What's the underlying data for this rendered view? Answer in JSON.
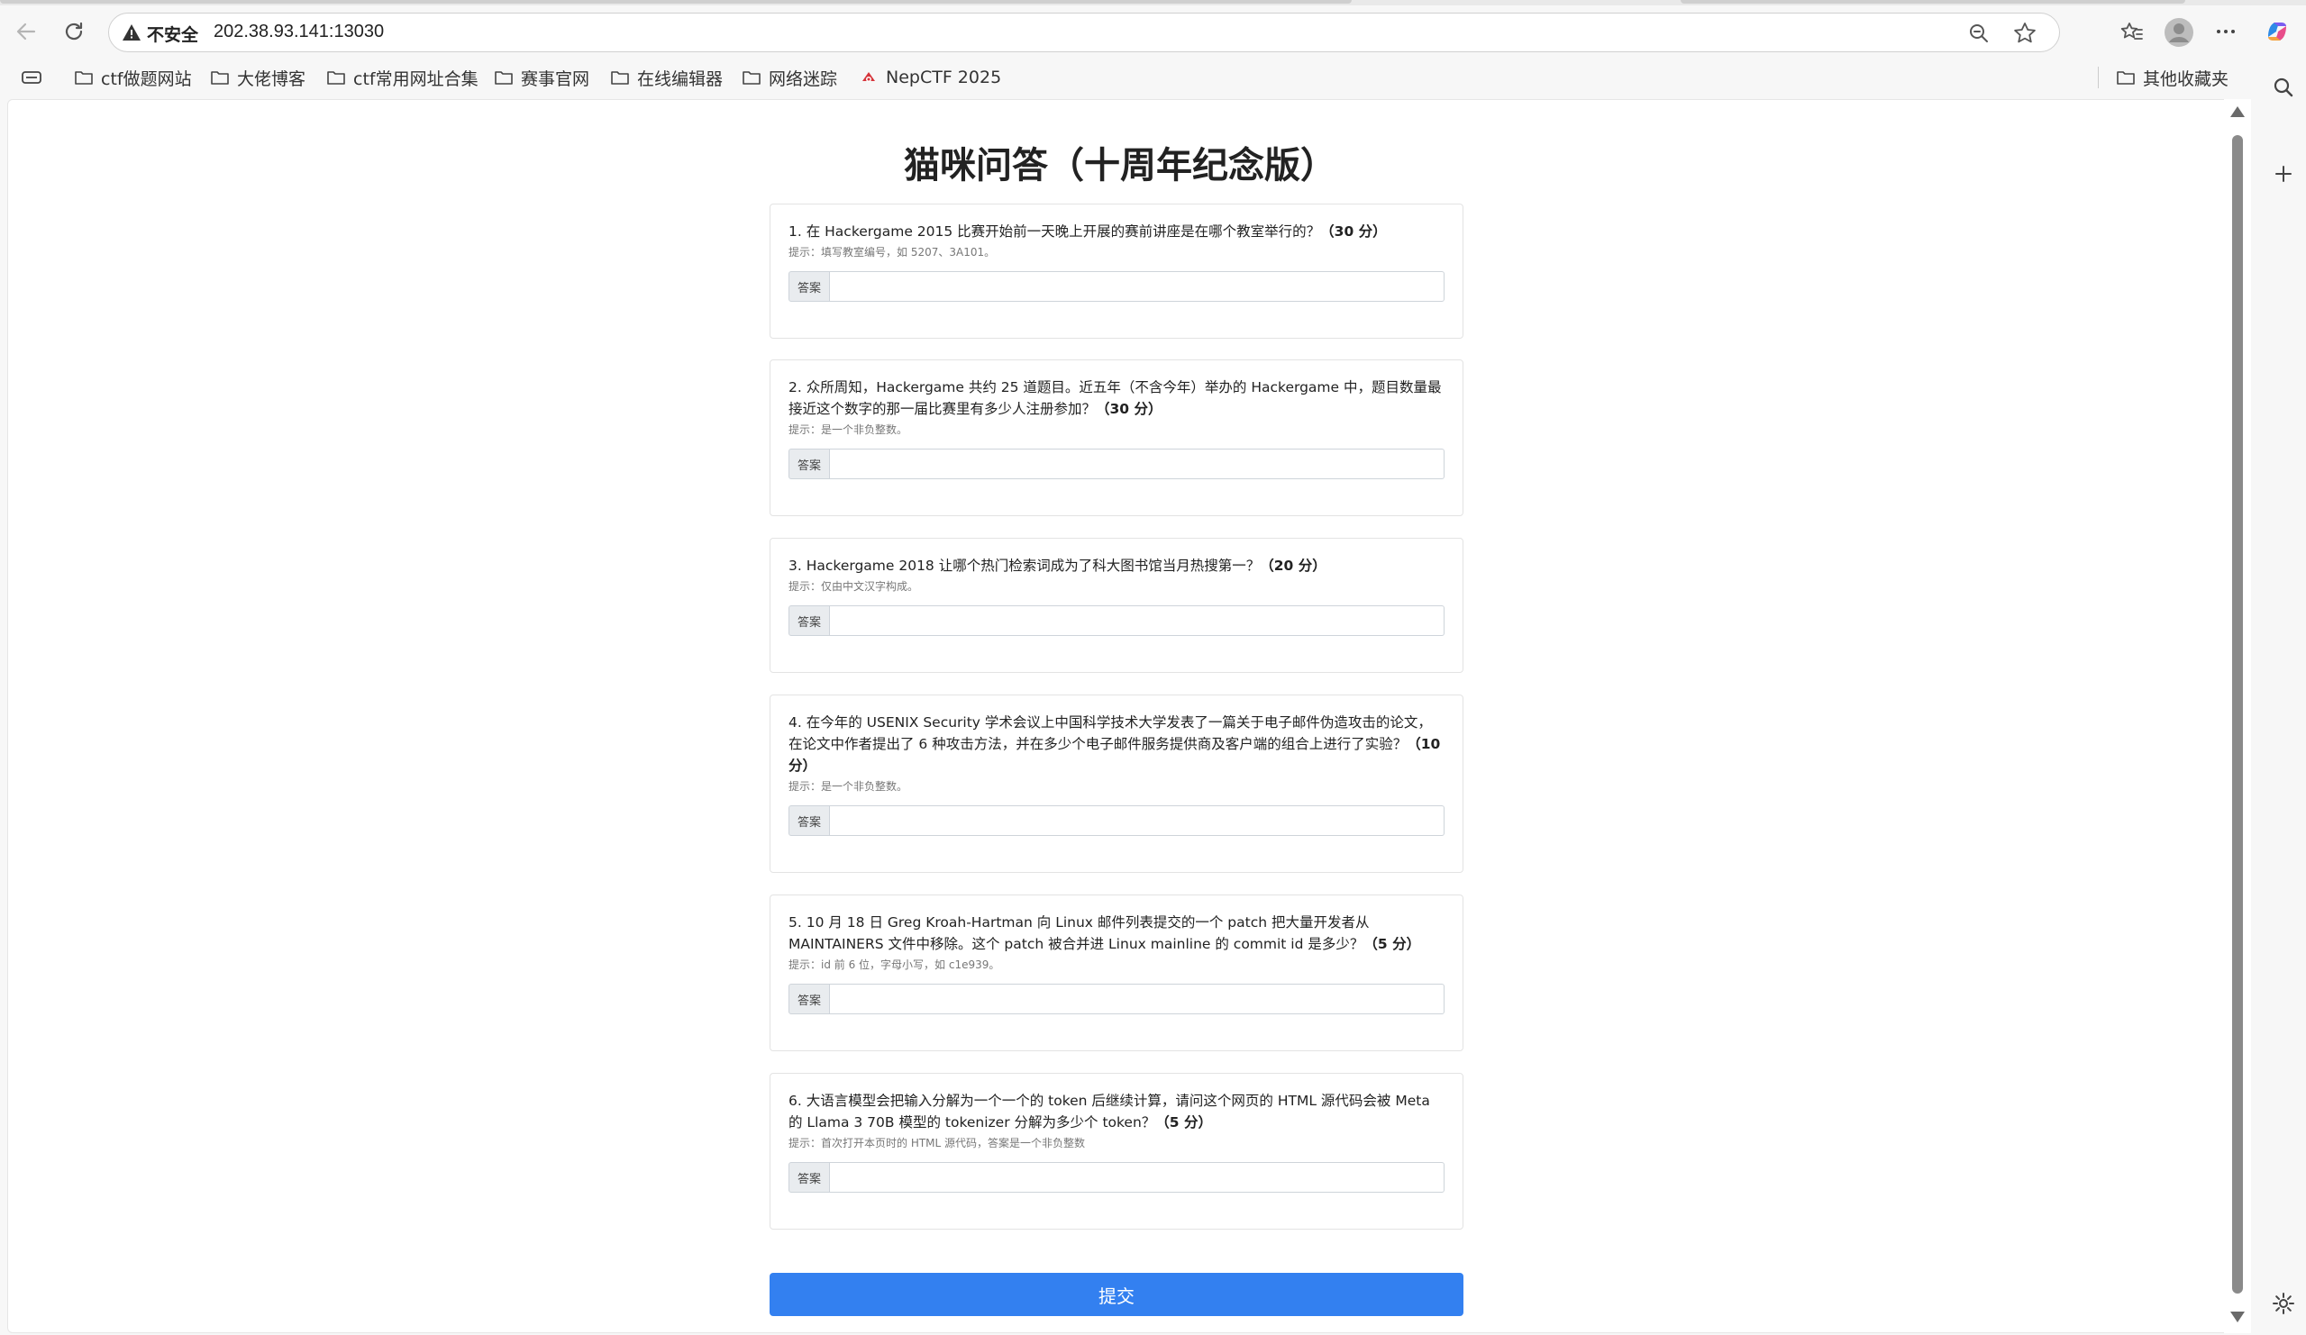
{
  "browser": {
    "insecure_label": "不安全",
    "url": "202.38.93.141:13030"
  },
  "bookmarks": [
    {
      "label": "ctf做题网站"
    },
    {
      "label": "大佬博客"
    },
    {
      "label": "ctf常用网址合集"
    },
    {
      "label": "赛事官网"
    },
    {
      "label": "在线编辑器"
    },
    {
      "label": "网络迷踪"
    },
    {
      "label": "NepCTF 2025"
    }
  ],
  "other_bookmarks": "其他收藏夹",
  "page": {
    "title": "猫咪问答（十周年纪念版）",
    "answer_label": "答案",
    "submit_label": "提交"
  },
  "questions": [
    {
      "text": "1. 在 Hackergame 2015 比赛开始前一天晚上开展的赛前讲座是在哪个教室举行的？",
      "points": "（30 分）",
      "hint": "提示：填写教室编号，如 5207、3A101。",
      "value": ""
    },
    {
      "text": "2. 众所周知，Hackergame 共约 25 道题目。近五年（不含今年）举办的 Hackergame 中，题目数量最接近这个数字的那一届比赛里有多少人注册参加？",
      "points": "（30 分）",
      "hint": "提示：是一个非负整数。",
      "value": ""
    },
    {
      "text": "3. Hackergame 2018 让哪个热门检索词成为了科大图书馆当月热搜第一？",
      "points": "（20 分）",
      "hint": "提示：仅由中文汉字构成。",
      "value": ""
    },
    {
      "text": "4. 在今年的 USENIX Security 学术会议上中国科学技术大学发表了一篇关于电子邮件伪造攻击的论文，在论文中作者提出了 6 种攻击方法，并在多少个电子邮件服务提供商及客户端的组合上进行了实验？",
      "points": "（10 分）",
      "hint": "提示：是一个非负整数。",
      "value": ""
    },
    {
      "text": "5. 10 月 18 日 Greg Kroah-Hartman 向 Linux 邮件列表提交的一个 patch 把大量开发者从 MAINTAINERS 文件中移除。这个 patch 被合并进 Linux mainline 的 commit id 是多少？",
      "points": "（5 分）",
      "hint": "提示：id 前 6 位，字母小写，如 c1e939。",
      "value": ""
    },
    {
      "text": "6. 大语言模型会把输入分解为一个一个的 token 后继续计算，请问这个网页的 HTML 源代码会被 Meta 的 Llama 3 70B 模型的 tokenizer 分解为多少个 token？",
      "points": "（5 分）",
      "hint": "提示：首次打开本页时的 HTML 源代码，答案是一个非负整数",
      "value": ""
    }
  ]
}
